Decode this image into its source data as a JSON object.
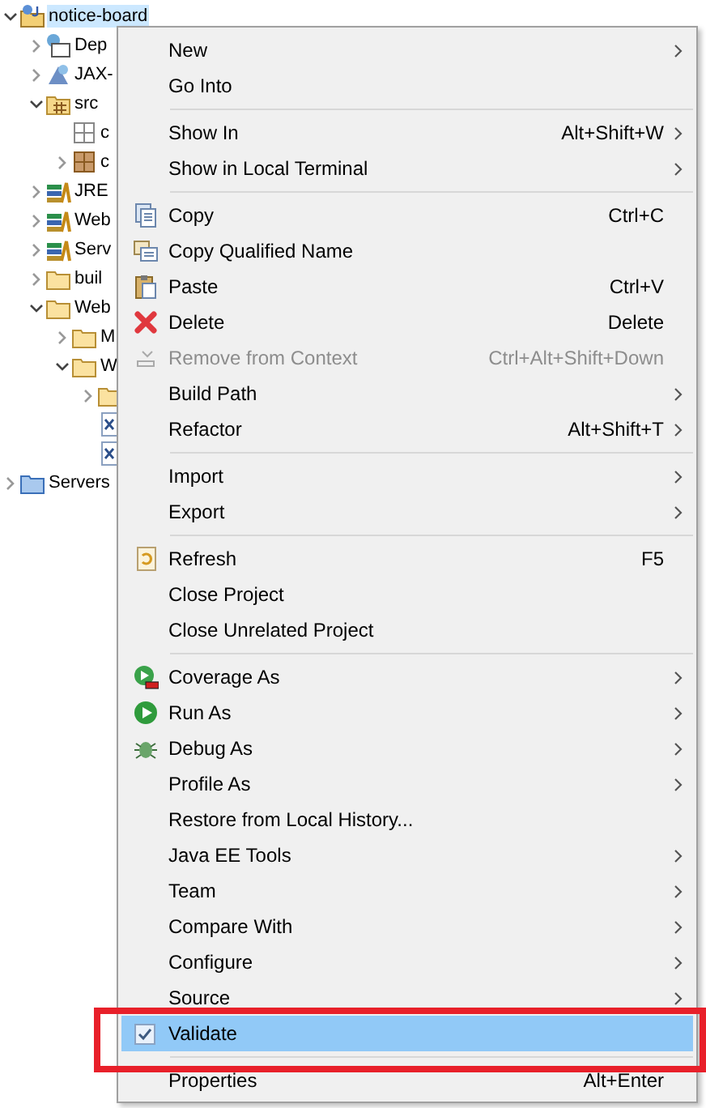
{
  "tree": [
    {
      "label": "notice-board",
      "kind": "project",
      "selected": true,
      "expanded": true,
      "children": [
        {
          "label": "Dep",
          "kind": "descriptor",
          "selected": false,
          "expanded": false
        },
        {
          "label": "JAX-",
          "kind": "webservice",
          "selected": false,
          "expanded": false
        },
        {
          "label": "src",
          "kind": "source-folder",
          "selected": false,
          "expanded": true,
          "children": [
            {
              "label": "c",
              "kind": "package-empty",
              "selected": false
            },
            {
              "label": "c",
              "kind": "package",
              "selected": false,
              "expanded": false
            }
          ]
        },
        {
          "label": "JRE",
          "kind": "library",
          "selected": false,
          "expanded": false
        },
        {
          "label": "Web",
          "kind": "library",
          "selected": false,
          "expanded": false
        },
        {
          "label": "Serv",
          "kind": "library",
          "selected": false,
          "expanded": false
        },
        {
          "label": "buil",
          "kind": "folder",
          "selected": false,
          "expanded": false
        },
        {
          "label": "Web",
          "kind": "folder",
          "selected": false,
          "expanded": true,
          "children": [
            {
              "label": "M",
              "kind": "folder",
              "selected": false,
              "expanded": false
            },
            {
              "label": "W",
              "kind": "folder",
              "selected": false,
              "expanded": true,
              "children": [
                {
                  "kind": "folder",
                  "selected": false,
                  "expanded": false
                },
                {
                  "kind": "xml-file",
                  "selected": false
                },
                {
                  "kind": "xml-file",
                  "selected": false
                }
              ]
            }
          ]
        }
      ]
    },
    {
      "label": "Servers",
      "kind": "servers-folder",
      "selected": false,
      "expanded": false
    }
  ],
  "context_menu": [
    {
      "kind": "item",
      "label": "New",
      "submenu": true
    },
    {
      "kind": "item",
      "label": "Go Into"
    },
    {
      "kind": "separator"
    },
    {
      "kind": "item",
      "label": "Show In",
      "shortcut": "Alt+Shift+W",
      "submenu": true
    },
    {
      "kind": "item",
      "label": "Show in Local Terminal",
      "submenu": true
    },
    {
      "kind": "separator"
    },
    {
      "kind": "copy",
      "label": "Copy",
      "shortcut": "Ctrl+C"
    },
    {
      "kind": "copy-name",
      "label": "Copy Qualified Name"
    },
    {
      "kind": "paste",
      "label": "Paste",
      "shortcut": "Ctrl+V"
    },
    {
      "kind": "delete",
      "label": "Delete",
      "shortcut": "Delete"
    },
    {
      "kind": "remove",
      "label": "Remove from Context",
      "shortcut": "Ctrl+Alt+Shift+Down",
      "disabled": true
    },
    {
      "kind": "item",
      "label": "Build Path",
      "submenu": true
    },
    {
      "kind": "item",
      "label": "Refactor",
      "shortcut": "Alt+Shift+T",
      "submenu": true
    },
    {
      "kind": "separator"
    },
    {
      "kind": "item",
      "label": "Import",
      "submenu": true
    },
    {
      "kind": "item",
      "label": "Export",
      "submenu": true
    },
    {
      "kind": "separator"
    },
    {
      "kind": "refresh",
      "label": "Refresh",
      "shortcut": "F5"
    },
    {
      "kind": "item",
      "label": "Close Project"
    },
    {
      "kind": "item",
      "label": "Close Unrelated Project"
    },
    {
      "kind": "separator"
    },
    {
      "kind": "coverage",
      "label": "Coverage As",
      "submenu": true
    },
    {
      "kind": "run",
      "label": "Run As",
      "submenu": true
    },
    {
      "kind": "debug",
      "label": "Debug As",
      "submenu": true
    },
    {
      "kind": "item",
      "label": "Profile As",
      "submenu": true
    },
    {
      "kind": "item",
      "label": "Restore from Local History..."
    },
    {
      "kind": "item",
      "label": "Java EE Tools",
      "submenu": true
    },
    {
      "kind": "item",
      "label": "Team",
      "submenu": true
    },
    {
      "kind": "item",
      "label": "Compare With",
      "submenu": true
    },
    {
      "kind": "item",
      "label": "Configure",
      "submenu": true
    },
    {
      "kind": "item",
      "label": "Source",
      "submenu": true
    },
    {
      "kind": "check",
      "label": "Validate",
      "checked": true,
      "selected": true
    },
    {
      "kind": "separator"
    },
    {
      "kind": "item",
      "label": "Properties",
      "shortcut": "Alt+Enter"
    }
  ],
  "annotation": {
    "kind": "box",
    "color": "#e8202a"
  }
}
